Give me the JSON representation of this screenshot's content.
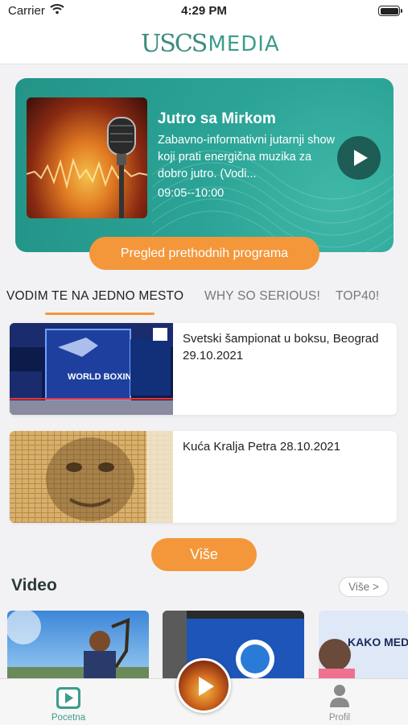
{
  "status_bar": {
    "carrier": "Carrier",
    "time": "4:29 PM"
  },
  "header": {
    "logo_mark": "USCS",
    "logo_text": "MEDIA"
  },
  "now_playing": {
    "title": "Jutro sa Mirkom",
    "description": "Zabavno-informativni jutarnji show koji prati energična muzika za dobro jutro. (Vodi...",
    "time": "09:05--10:00",
    "play_icon": "play-icon",
    "previous_programs_label": "Pregled prethodnih programa"
  },
  "tabs": [
    {
      "label": "VODIM TE NA JEDNO MESTO",
      "active": true
    },
    {
      "label": "WHY SO SERIOUS!",
      "active": false
    },
    {
      "label": "TOP40!",
      "active": false
    }
  ],
  "news": [
    {
      "title": "Svetski šampionat u boksu, Beograd 29.10.2021",
      "thumb_caption": "WORLD BOXING"
    },
    {
      "title": "Kuća Kralja Petra 28.10.2021"
    }
  ],
  "more_label": "Više",
  "video_section": {
    "title": "Video",
    "more_label": "Više >",
    "thumb3_caption": "KAKO MED"
  },
  "bottom_tabs": {
    "home_label": "Pocetna",
    "profile_label": "Profil"
  },
  "colors": {
    "accent_orange": "#f4973b",
    "teal": "#2aa396",
    "dark_teal": "#1d5d55"
  }
}
